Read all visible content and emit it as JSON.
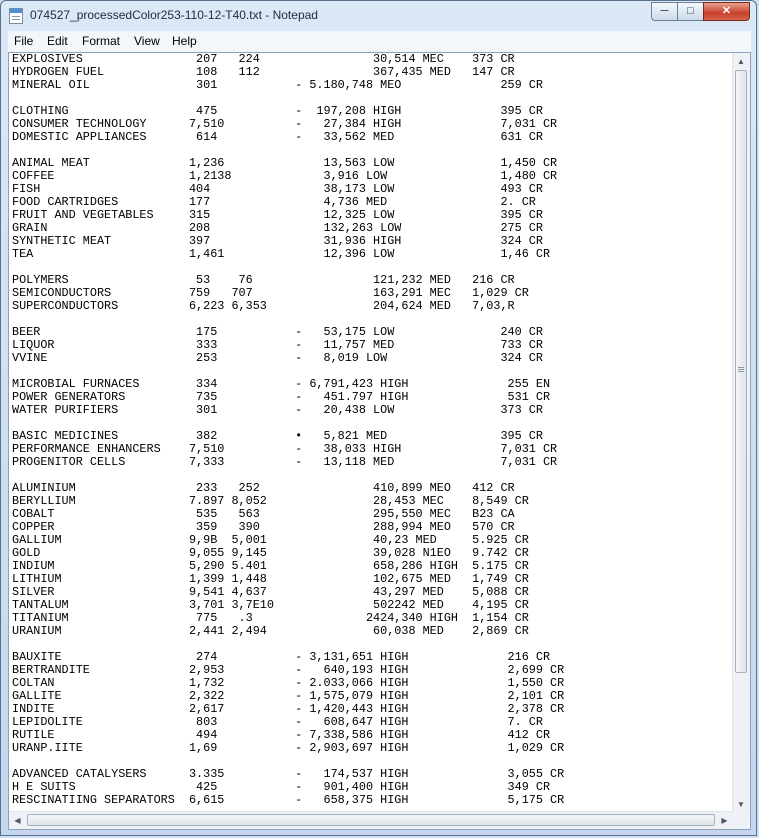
{
  "window": {
    "title": "074527_processedColor253-110-12-T40.txt - Notepad",
    "minimize_glyph": "─",
    "maximize_glyph": "□",
    "close_glyph": "✕"
  },
  "menu": {
    "file": "File",
    "edit": "Edit",
    "format": "Format",
    "view": "View",
    "help": "Help"
  },
  "document": {
    "lines": [
      "EXPLOSIVES                207   224                30,514 MEC    373 CR",
      "HYDROGEN FUEL             108   112                367,435 MED   147 CR",
      "MINERAL OIL               301           - 5.180,748 MEO              259 CR",
      "",
      "CLOTHING                  475           -  197,208 HIGH              395 CR",
      "CONSUMER TECHNOLOGY      7,510          -   27,384 HIGH              7,031 CR",
      "DOMESTIC APPLIANCES       614           -   33,562 MED               631 CR",
      "",
      "ANIMAL MEAT              1,236              13,563 LOW               1,450 CR",
      "COFFEE                   1,2138             3,916 LOW                1,480 CR",
      "FISH                     404                38,173 LOW               493 CR",
      "FOOD CARTRIDGES          177                4,736 MED                2. CR",
      "FRUIT AND VEGETABLES     315                12,325 LOW               395 CR",
      "GRAIN                    208                132,263 LOW              275 CR",
      "SYNTHETIC MEAT           397                31,936 HIGH              324 CR",
      "TEA                      1,461              12,396 LOW               1,46 CR",
      "",
      "POLYMERS                  53    76                 121,232 MED   216 CR",
      "SEMICONDUCTORS           759   707                 163,291 MEC   1,029 CR",
      "SUPERCONDUCTORS          6,223 6,353               204,624 MED   7,03,R",
      "",
      "BEER                      175           -   53,175 LOW               240 CR",
      "LIQUOR                    333           -   11,757 MED               733 CR",
      "VVINE                     253           -   8,019 LOW                324 CR",
      "",
      "MICROBIAL FURNACES        334           - 6,791,423 HIGH              255 EN",
      "POWER GENERATORS          735           -   451.797 HIGH              531 CR",
      "WATER PURIFIERS           301           -   20,438 LOW               373 CR",
      "",
      "BASIC MEDICINES           382           •   5,821 MED                395 CR",
      "PERFORMANCE ENHANCERS    7,510          -   38,033 HIGH              7,031 CR",
      "PROGENITOR CELLS         7,333          -   13,118 MED               7,031 CR",
      "",
      "ALUMINIUM                 233   252                410,899 MEO   412 CR",
      "BERYLLIUM                7.897 8,052               28,453 MEC    8,549 CR",
      "COBALT                    535   563                295,550 MEC   B23 CA",
      "COPPER                    359   390                288,994 MEO   570 CR",
      "GALLIUM                  9,9B  5,001               40,23 MED     5.925 CR",
      "GOLD                     9,055 9,145               39,028 N1EO   9.742 CR",
      "INDIUM                   5,290 5.401               658,286 HIGH  5.175 CR",
      "LITHIUM                  1,399 1,448               102,675 MED   1,749 CR",
      "SILVER                   9,541 4,637               43,297 MED    5,088 CR",
      "TANTALUM                 3,701 3,7E10              502242 MED    4,195 CR",
      "TITANIUM                  775   .3                2424,340 HIGH  1,154 CR",
      "URANIUM                  2,441 2,494               60,038 MED    2,869 CR",
      "",
      "BAUXITE                   274           - 3,131,651 HIGH              216 CR",
      "BERTRANDITE              2,953          -   640,193 HIGH              2,699 CR",
      "COLTAN                   1,732          - 2.033,066 HIGH              1,550 CR",
      "GALLITE                  2,322          - 1,575,079 HIGH              2,101 CR",
      "INDITE                   2,617          - 1,420,443 HIGH              2,378 CR",
      "LEPIDOLITE                803           -   608,647 HIGH              7. CR",
      "RUTILE                    494           - 7,338,586 HIGH              412 CR",
      "URANP.IITE               1,69           - 2,903,697 HIGH              1,029 CR",
      "",
      "ADVANCED CATALYSERS      3.335          -   174,537 HIGH              3,055 CR",
      "H E SUITS                 425           -   901,400 HIGH              349 CR",
      "RESCINATIING SEPARATORS  6,615          -   658,375 HIGH              5,175 CR"
    ]
  }
}
